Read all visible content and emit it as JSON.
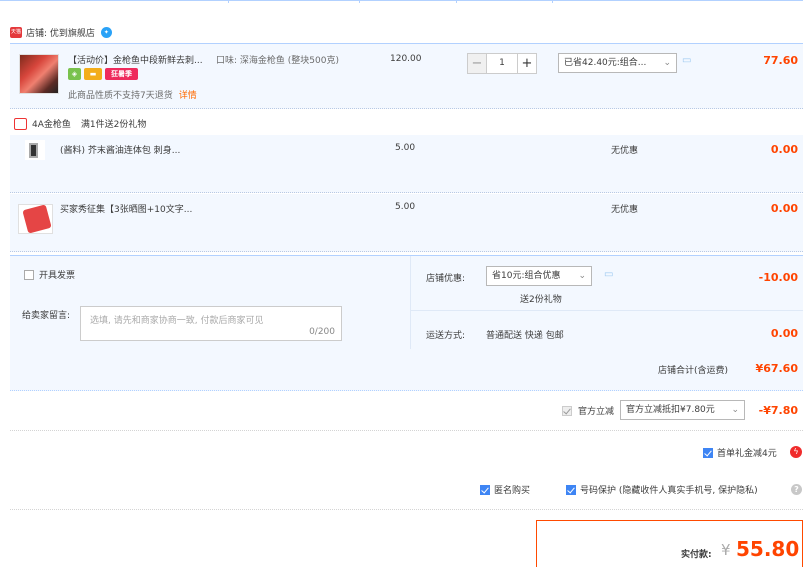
{
  "shop": {
    "badge": "天猫",
    "name": "店铺: 优到旗舰店"
  },
  "item": {
    "title": "【活动价】金枪鱼中段新鲜去刺...",
    "sku": "口味: 深海金枪鱼 (整块500克)",
    "tag_c": "狂暑季",
    "no_return": "此商品性质不支持7天退货",
    "detail_link": "详情",
    "price": "120.00",
    "qty": "1",
    "promo": "已省42.40元:组合...",
    "subtotal": "77.60"
  },
  "gift": {
    "title": "4A金枪鱼",
    "rule": "满1件送2份礼物"
  },
  "gifts": [
    {
      "title": "(酱料) 芥末酱油连体包 刺身...",
      "price": "5.00",
      "discount": "无优惠",
      "subtotal": "0.00"
    },
    {
      "title": "买家秀征集【3张晒图+10文字...",
      "price": "5.00",
      "discount": "无优惠",
      "subtotal": "0.00"
    }
  ],
  "order": {
    "invoice_label": "开具发票",
    "message_label": "给卖家留言:",
    "message_placeholder": "选填, 请先和商家协商一致, 付款后商家可见",
    "message_count": "0/200",
    "shop_discount_label": "店铺优惠:",
    "shop_discount_sel": "省10元:组合优惠",
    "shop_discount_gift": "送2份礼物",
    "shop_discount_amt": "-10.00",
    "shipping_label": "运送方式:",
    "shipping_value": "普通配送 快递 包邮",
    "shipping_amt": "0.00",
    "shop_total_label": "店铺合计(含运费)",
    "shop_total_amt": "¥67.60"
  },
  "official": {
    "label": "官方立减",
    "sel": "官方立减抵扣¥7.80元",
    "amt": "-¥7.80"
  },
  "first_gift": {
    "label": "首单礼金减4元"
  },
  "options": {
    "anonymous": "匿名购买",
    "privacy": "号码保护 (隐藏收件人真实手机号, 保护隐私)"
  },
  "pay": {
    "label": "实付款:",
    "currency": "¥",
    "amount": "55.80"
  },
  "colors": {
    "accent_red": "#ff4400",
    "accent_blue": "#3e85f4",
    "row_bg": "#f3f8ff"
  }
}
